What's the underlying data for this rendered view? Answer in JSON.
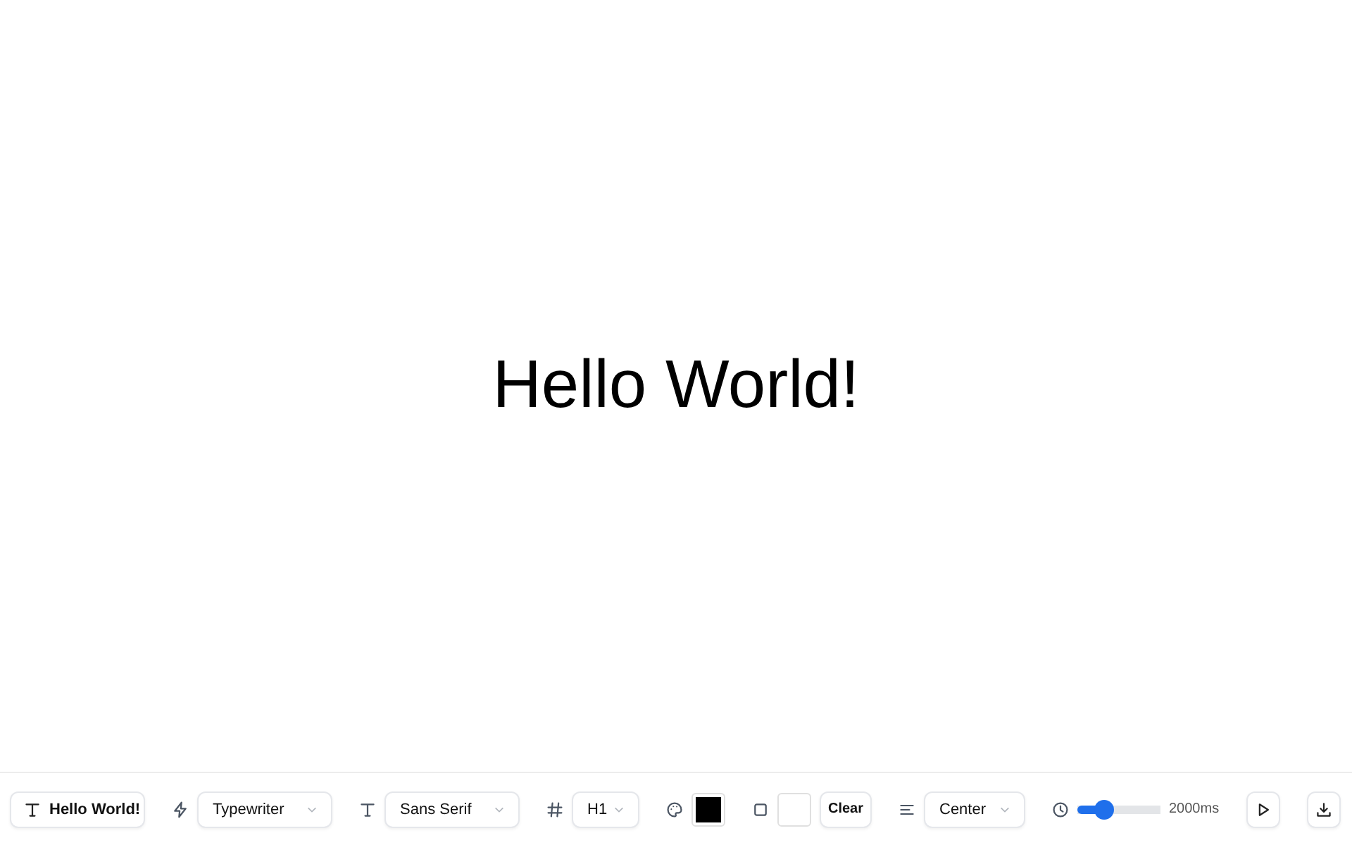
{
  "canvas": {
    "text": "Hello World!"
  },
  "toolbar": {
    "text_button": {
      "label": "Hello World!"
    },
    "animation": {
      "value": "Typewriter"
    },
    "font": {
      "value": "Sans Serif"
    },
    "heading": {
      "value": "H1"
    },
    "text_color": {
      "color": "#000000"
    },
    "background_color": {
      "color": "#ffffff"
    },
    "clear_button": {
      "label": "Clear"
    },
    "alignment": {
      "value": "Center"
    },
    "duration": {
      "level": 0.33,
      "reading": "2000ms"
    }
  }
}
